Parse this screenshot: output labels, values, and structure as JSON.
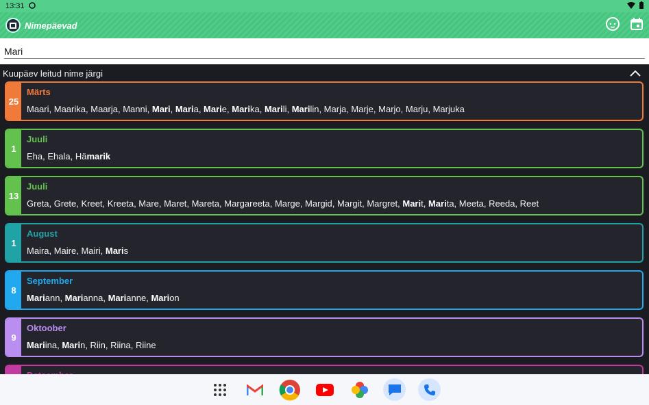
{
  "status": {
    "time": "13:31"
  },
  "app": {
    "title": "Nimepäevad"
  },
  "search": {
    "value": "Mari"
  },
  "section": {
    "title": "Kuupäev leitud nime järgi"
  },
  "cards": [
    {
      "day": "25",
      "month": "Märts",
      "color": "#f07a3a",
      "names": [
        [
          "Maari",
          ""
        ],
        ", ",
        [
          "Maarika",
          ""
        ],
        ", ",
        [
          "Maarja",
          ""
        ],
        ", ",
        [
          "Manni",
          ""
        ],
        ", ",
        [
          "Mari",
          "b"
        ],
        ", ",
        [
          "Mari",
          "b",
          "a"
        ],
        ", ",
        [
          "Mari",
          "b",
          "e"
        ],
        ", ",
        [
          "Mari",
          "b",
          "ka"
        ],
        ", ",
        [
          "Mari",
          "b",
          "li"
        ],
        ", ",
        [
          "Mari",
          "b",
          "lin"
        ],
        ", Marja, Marje, Marjo, Marju, Marjuka"
      ]
    },
    {
      "day": "1",
      "month": "Juuli",
      "color": "#63c24d",
      "names": [
        "Eha, Ehala, Hä",
        [
          "marik",
          "b"
        ]
      ]
    },
    {
      "day": "13",
      "month": "Juuli",
      "color": "#63c24d",
      "names": [
        "Greta, Grete, Kreet, Kreeta, Mare, Maret, Mareta, Margareeta, Marge, Margid, Margit, Margret, ",
        [
          "Mari",
          "b",
          "t"
        ],
        ", ",
        [
          "Mari",
          "b",
          "ta"
        ],
        ", Meeta, Reeda, Reet"
      ]
    },
    {
      "day": "1",
      "month": "August",
      "color": "#20a3a6",
      "names": [
        "Maira, Maire, Mairi, ",
        [
          "Mari",
          "b",
          "s"
        ]
      ]
    },
    {
      "day": "8",
      "month": "September",
      "color": "#21a8ee",
      "names": [
        [
          "Mari",
          "b",
          "ann"
        ],
        ", ",
        [
          "Mari",
          "b",
          "anna"
        ],
        ", ",
        [
          "Mari",
          "b",
          "anne"
        ],
        ", ",
        [
          "Mari",
          "b",
          "on"
        ]
      ]
    },
    {
      "day": "9",
      "month": "Oktoober",
      "color": "#b98ef0",
      "names": [
        [
          "Mari",
          "b",
          "ina"
        ],
        ", ",
        [
          "Mari",
          "b",
          "n"
        ],
        ", Riin, Riina, Riine"
      ]
    },
    {
      "day": "",
      "month": "Detsember",
      "color": "#c03aa0",
      "names": []
    }
  ],
  "icons": {
    "status": [
      "wifi-icon",
      "battery-icon"
    ],
    "appbar": [
      "baby-face-icon",
      "calendar-icon"
    ],
    "dock": [
      "app-drawer-icon",
      "gmail-icon",
      "chrome-icon",
      "youtube-icon",
      "photos-icon",
      "messages-icon",
      "phone-icon"
    ]
  }
}
